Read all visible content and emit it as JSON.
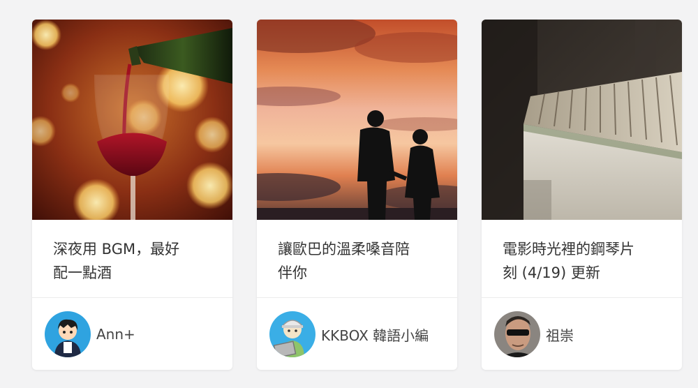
{
  "playlists": [
    {
      "title_line1": "深夜用 BGM，最好",
      "title_line2": "配一點酒",
      "cover_icon": "wine-glass-bokeh-photo",
      "author": {
        "name": "Ann+",
        "avatar_icon": "cartoon-boy-avatar"
      }
    },
    {
      "title_line1": "讓歐巴的溫柔嗓音陪",
      "title_line2": "伴你",
      "cover_icon": "couple-sunset-silhouette-photo",
      "author": {
        "name": "KKBOX 韓語小編",
        "avatar_icon": "cartoon-laptop-avatar"
      }
    },
    {
      "title_line1": "電影時光裡的鋼琴片",
      "title_line2": "刻 (4/19) 更新",
      "cover_icon": "piano-keys-photo",
      "author": {
        "name": "祖崇",
        "avatar_icon": "sunglasses-man-avatar"
      }
    }
  ]
}
